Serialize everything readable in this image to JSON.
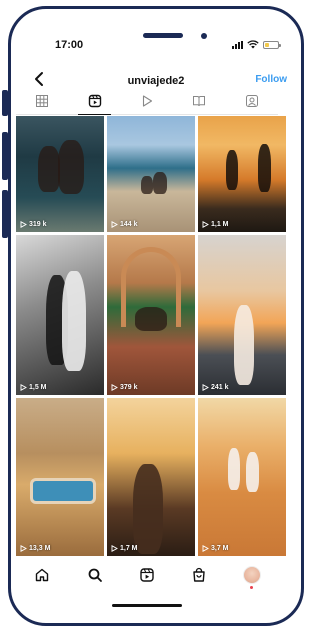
{
  "status_bar": {
    "time": "17:00",
    "icons": [
      "signal-icon",
      "wifi-icon",
      "battery-icon"
    ]
  },
  "header": {
    "back_icon": "chevron-left-icon",
    "username": "unviajede2",
    "follow_label": "Follow",
    "follow_color": "#3b9cf0"
  },
  "tabs": [
    {
      "icon": "grid-icon",
      "active": false
    },
    {
      "icon": "reels-icon",
      "active": true
    },
    {
      "icon": "play-icon",
      "active": false
    },
    {
      "icon": "guide-icon",
      "active": false
    },
    {
      "icon": "tagged-icon",
      "active": false
    }
  ],
  "grid": {
    "tiles": [
      {
        "views": "319 k"
      },
      {
        "views": "144 k"
      },
      {
        "views": "1,1 M"
      },
      {
        "views": "1,5 M"
      },
      {
        "views": "379 k"
      },
      {
        "views": "241 k"
      },
      {
        "views": "13,3 M"
      },
      {
        "views": "1,7 M"
      },
      {
        "views": "3,7 M"
      }
    ]
  },
  "bottom_nav": [
    {
      "icon": "home-icon"
    },
    {
      "icon": "search-icon"
    },
    {
      "icon": "reels-icon"
    },
    {
      "icon": "shop-icon"
    },
    {
      "icon": "profile-avatar"
    }
  ],
  "colors": {
    "frame": "#1b2a55",
    "accent": "#3b9cf0",
    "notification_dot": "#e8414f"
  }
}
